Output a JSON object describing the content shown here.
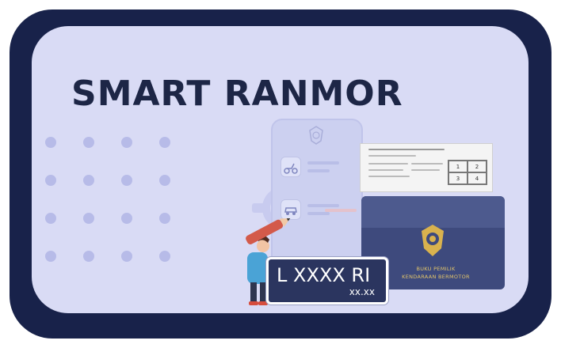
{
  "title": "SMART RANMOR",
  "plate": {
    "number": "L XXXX RI",
    "expiry": "xx.xx"
  },
  "book": {
    "line1": "BUKU PEMILIK",
    "line2": "KENDARAAN BERMOTOR"
  },
  "document_grid": [
    "1",
    "2",
    "3",
    "4"
  ],
  "colors": {
    "card": "#d9dbf5",
    "title": "#1d2646",
    "book": "#3e4a7d",
    "plate": "#2b355f",
    "emblem": "#d9b24e"
  },
  "icons": [
    "scooter-icon",
    "car-icon",
    "pencil-icon",
    "police-emblem-icon",
    "gear-icon"
  ]
}
